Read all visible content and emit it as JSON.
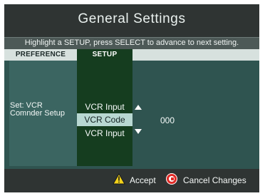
{
  "header": {
    "title": "General Settings",
    "instruction": "Highlight a SETUP, press SELECT to advance to next setting."
  },
  "tabs": {
    "preference": "PREFERENCE",
    "setup": "SETUP"
  },
  "preference": {
    "label": "Set: VCR Comnder Setup"
  },
  "setup": {
    "options": [
      {
        "label": "VCR Input"
      },
      {
        "label": "VCR Code"
      },
      {
        "label": "VCR Input"
      }
    ],
    "selected_index": 1,
    "value": "000"
  },
  "footer": {
    "accept_label": "Accept",
    "cancel_label": "Cancel Changes"
  },
  "colors": {
    "background": "#2f5450",
    "title_bar": "#2f3433",
    "setup_column": "#153d1f",
    "selected_row": "#b8d8d2",
    "accept_icon": "#f3d31b",
    "cancel_icon": "#e02a25"
  },
  "icons": {
    "up": "up-arrow-icon",
    "down": "down-arrow-icon",
    "accept": "warning-triangle-icon",
    "cancel": "cancel-icon"
  }
}
